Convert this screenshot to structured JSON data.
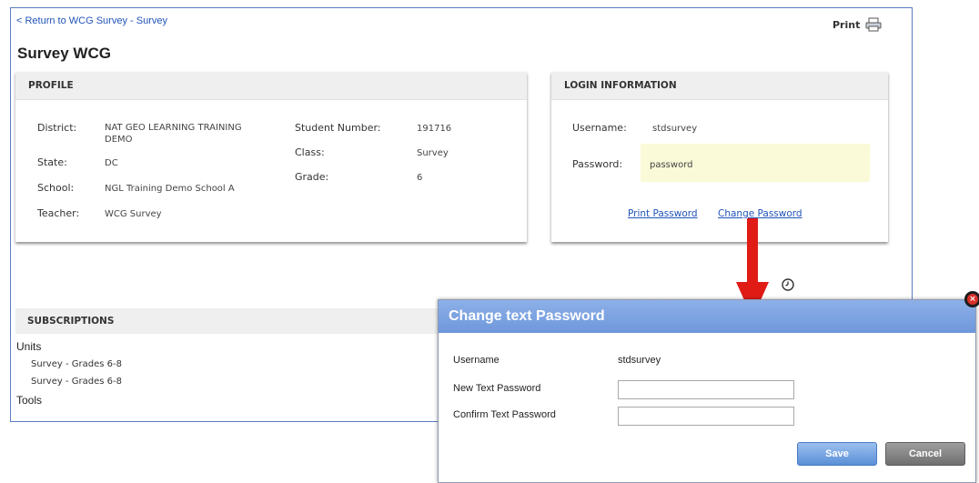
{
  "nav": {
    "back_link": "< Return to WCG Survey - Survey",
    "print_label": "Print"
  },
  "page": {
    "title": "Survey WCG"
  },
  "profile": {
    "heading": "PROFILE",
    "district_label": "District:",
    "district_value": "NAT GEO LEARNING TRAINING DEMO",
    "state_label": "State:",
    "state_value": "DC",
    "school_label": "School:",
    "school_value": "NGL Training Demo School A",
    "teacher_label": "Teacher:",
    "teacher_value": "WCG Survey",
    "student_number_label": "Student Number:",
    "student_number_value": "191716",
    "class_label": "Class:",
    "class_value": "Survey",
    "grade_label": "Grade:",
    "grade_value": "6"
  },
  "login": {
    "heading": "LOGIN INFORMATION",
    "username_label": "Username:",
    "username_value": "stdsurvey",
    "password_label": "Password:",
    "password_value": "password",
    "print_password": "Print Password",
    "change_password": "Change Password"
  },
  "subscriptions": {
    "heading": "SUBSCRIPTIONS",
    "units_label": "Units",
    "units": [
      "Survey - Grades 6-8",
      "Survey - Grades 6-8"
    ],
    "tools_label": "Tools"
  },
  "dialog": {
    "title": "Change text Password",
    "username_label": "Username",
    "username_value": "stdsurvey",
    "new_password_label": "New Text Password",
    "new_password_value": "",
    "confirm_password_label": "Confirm Text Password",
    "confirm_password_value": "",
    "save_label": "Save",
    "cancel_label": "Cancel"
  },
  "colors": {
    "link": "#2154b8",
    "frame_border": "#5b7fc1",
    "dialog_header": "#7aa0df",
    "password_highlight": "#fafad8",
    "annotation_arrow": "#e01b16"
  },
  "icons": {
    "printer": "printer-icon",
    "clock": "clock-icon",
    "close": "close-icon",
    "arrow": "annotation-arrow"
  }
}
